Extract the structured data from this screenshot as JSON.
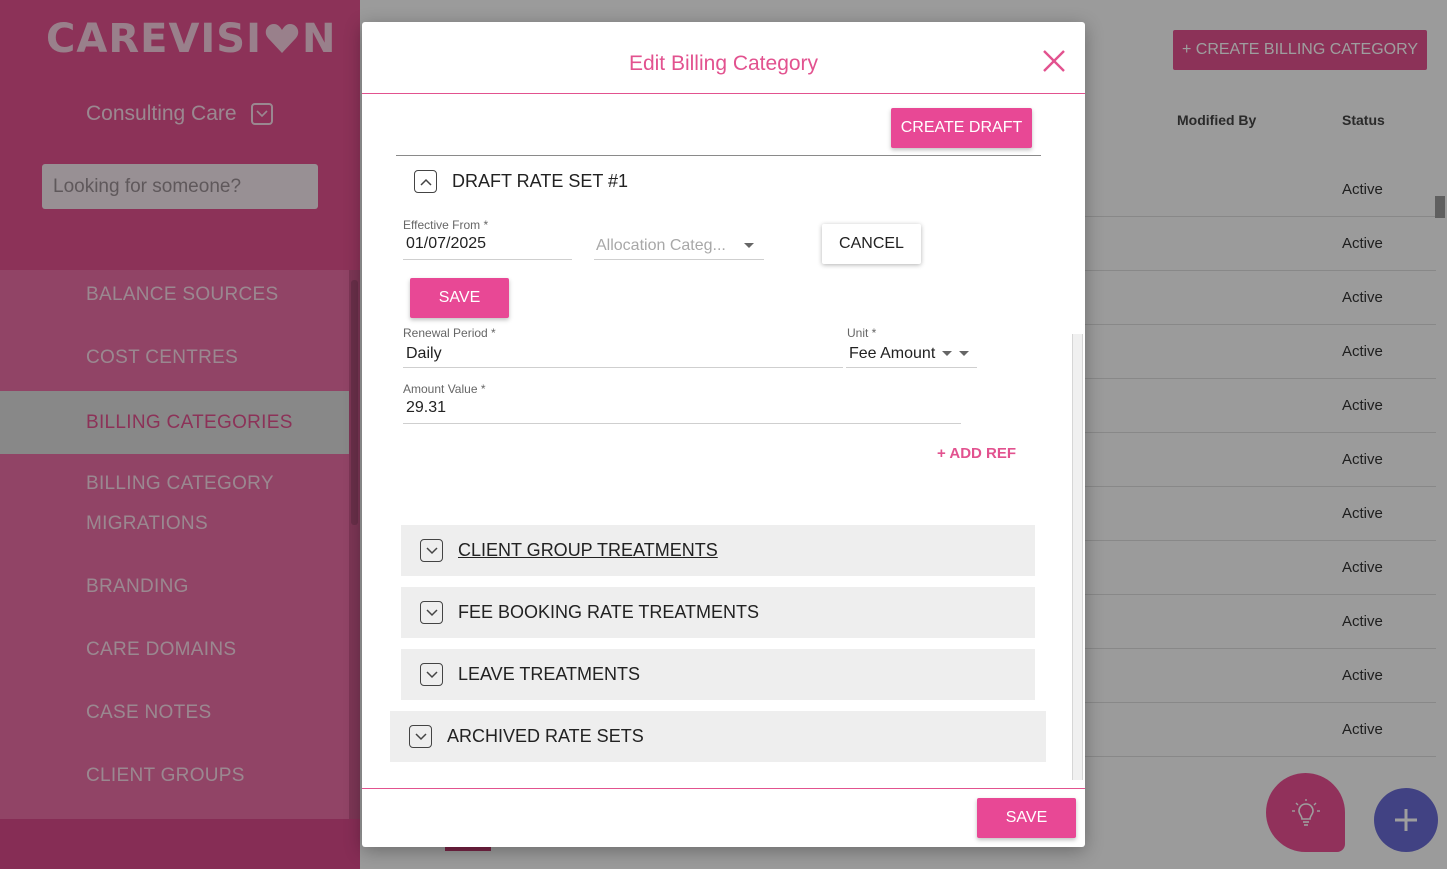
{
  "brand": {
    "logo_prefix": "CAREVISI",
    "logo_suffix": "N",
    "accent": "#e2528f"
  },
  "sidebar": {
    "org_name": "Consulting Care",
    "search_placeholder": "Looking for someone?",
    "items": [
      {
        "label": "BALANCE SOURCES"
      },
      {
        "label": "COST CENTRES"
      },
      {
        "label": "BILLING CATEGORIES",
        "active": true
      },
      {
        "label": "BILLING CATEGORY"
      },
      {
        "label": "MIGRATIONS"
      },
      {
        "label": "BRANDING"
      },
      {
        "label": "CARE DOMAINS"
      },
      {
        "label": "CASE NOTES"
      },
      {
        "label": "CLIENT GROUPS"
      }
    ]
  },
  "main": {
    "create_button": "+ CREATE BILLING CATEGORY",
    "columns": {
      "modified_by": "Modified By",
      "status": "Status"
    },
    "rows": [
      "Active",
      "Active",
      "Active",
      "Active",
      "Active",
      "Active",
      "Active",
      "Active",
      "Active",
      "Active",
      "Active"
    ]
  },
  "modal": {
    "title": "Edit Billing Category",
    "create_draft": "CREATE DRAFT",
    "draft": {
      "title": "DRAFT RATE SET #1",
      "effective_from_label": "Effective From *",
      "effective_from_value": "01/07/2025",
      "allocation_placeholder": "Allocation Categ...",
      "cancel": "CANCEL",
      "save": "SAVE",
      "renewal_label": "Renewal Period *",
      "renewal_value": "Daily",
      "unit_label": "Unit *",
      "unit_value": "Fee Amount",
      "amount_label": "Amount Value *",
      "amount_value": "29.31",
      "add_ref": "+ ADD REF"
    },
    "sections": [
      {
        "label": "CLIENT GROUP TREATMENTS"
      },
      {
        "label": "FEE BOOKING RATE TREATMENTS"
      },
      {
        "label": "LEAVE TREATMENTS"
      },
      {
        "label": "ARCHIVED RATE SETS"
      }
    ],
    "footer_save": "SAVE"
  }
}
